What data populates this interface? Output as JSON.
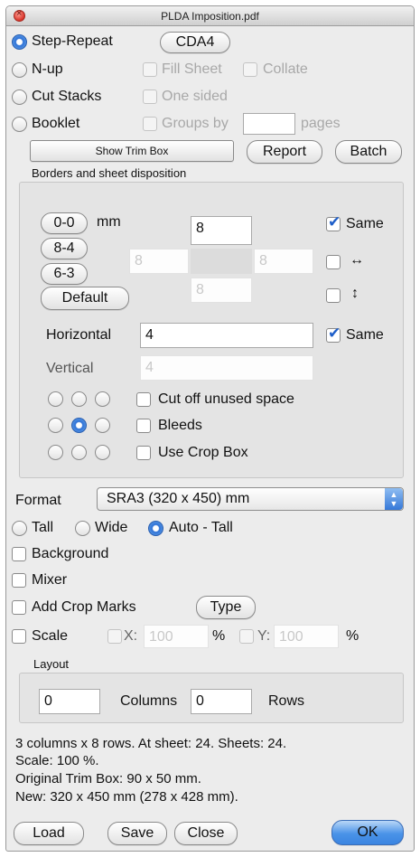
{
  "window": {
    "title": "PLDA Imposition.pdf"
  },
  "mode": {
    "step_repeat": "Step-Repeat",
    "cda4": "CDA4",
    "n_up": "N-up",
    "fill_sheet": "Fill Sheet",
    "collate": "Collate",
    "cut_stacks": "Cut Stacks",
    "one_sided": "One sided",
    "booklet": "Booklet",
    "groups_by": "Groups by",
    "groups_value": "",
    "pages": "pages",
    "selected": "Step-Repeat"
  },
  "actions": {
    "show_trim_box": "Show Trim Box",
    "report": "Report",
    "batch": "Batch"
  },
  "borders": {
    "section_label": "Borders and sheet disposition",
    "presets": [
      "0-0",
      "8-4",
      "6-3"
    ],
    "unit": "mm",
    "default": "Default",
    "top": "8",
    "left": "8",
    "right": "8",
    "bottom": "8",
    "same_label": "Same",
    "same_checked": true,
    "horiz_arrow": "↔",
    "vert_arrow": "↕",
    "horizontal_label": "Horizontal",
    "horizontal_value": "4",
    "h_same_label": "Same",
    "h_same_checked": true,
    "vertical_label": "Vertical",
    "vertical_value": "4",
    "cut_off": "Cut off unused space",
    "bleeds": "Bleeds",
    "use_crop_box": "Use Crop Box",
    "anchor_selected": "center"
  },
  "format": {
    "label": "Format",
    "value": "SRA3 (320 x 450) mm",
    "tall": "Tall",
    "wide": "Wide",
    "auto_tall": "Auto - Tall",
    "orientation_selected": "Auto - Tall",
    "background": "Background",
    "mixer": "Mixer",
    "add_crop_marks": "Add Crop Marks",
    "type": "Type",
    "scale": "Scale",
    "x_label": "X:",
    "x_value": "100",
    "y_label": "Y:",
    "y_value": "100",
    "pct": "%"
  },
  "layout": {
    "label": "Layout",
    "columns_value": "0",
    "columns_label": "Columns",
    "rows_value": "0",
    "rows_label": "Rows"
  },
  "summary": {
    "line1": "3 columns x 8 rows. At sheet: 24. Sheets: 24.",
    "line2": "Scale: 100 %.",
    "line3": "Original Trim Box: 90 x 50 mm.",
    "line4": "New: 320 x 450 mm (278 x 428 mm)."
  },
  "footer": {
    "load": "Load",
    "save": "Save",
    "close": "Close",
    "ok": "OK"
  },
  "colors": {
    "accent": "#3a84e0",
    "window_bg": "#ececec"
  }
}
